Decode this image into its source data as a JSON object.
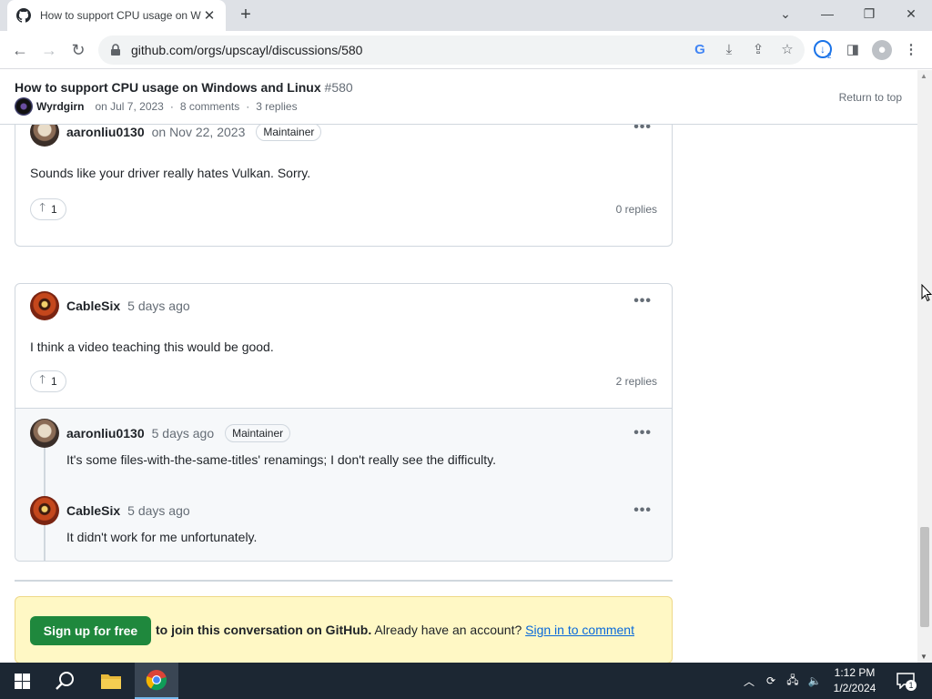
{
  "browser": {
    "tab_title": "How to support CPU usage on W",
    "url": "github.com/orgs/upscayl/discussions/580",
    "download_badge": "2"
  },
  "sticky_header": {
    "title": "How to support CPU usage on Windows and Linux",
    "number": "#580",
    "author": "Wyrdgirn",
    "date": "on Jul 7, 2023",
    "comments": "8 comments",
    "replies": "3 replies",
    "return_to_top": "Return to top"
  },
  "comments": [
    {
      "author": "aaronliu0130",
      "date": "on Nov 22, 2023",
      "badge": "Maintainer",
      "body": "Sounds like your driver really hates Vulkan. Sorry.",
      "upvotes": "1",
      "replies_label": "0 replies"
    },
    {
      "author": "CableSix",
      "date": "5 days ago",
      "body": "I think a video teaching this would be good.",
      "upvotes": "1",
      "replies_label": "2 replies",
      "replies": [
        {
          "author": "aaronliu0130",
          "date": "5 days ago",
          "badge": "Maintainer",
          "body": "It's some files-with-the-same-titles' renamings; I don't really see the difficulty."
        },
        {
          "author": "CableSix",
          "date": "5 days ago",
          "body": "It didn't work for me unfortunately."
        }
      ]
    }
  ],
  "signup": {
    "button": "Sign up for free",
    "text": "to join this conversation on GitHub.",
    "text2": "Already have an account?",
    "link": "Sign in to comment"
  },
  "taskbar": {
    "time": "1:12 PM",
    "date": "1/2/2024",
    "notification_count": "1"
  },
  "colors": {
    "signup_button": "#1f883d",
    "signup_banner": "#fff8c5",
    "link": "#0969da"
  }
}
